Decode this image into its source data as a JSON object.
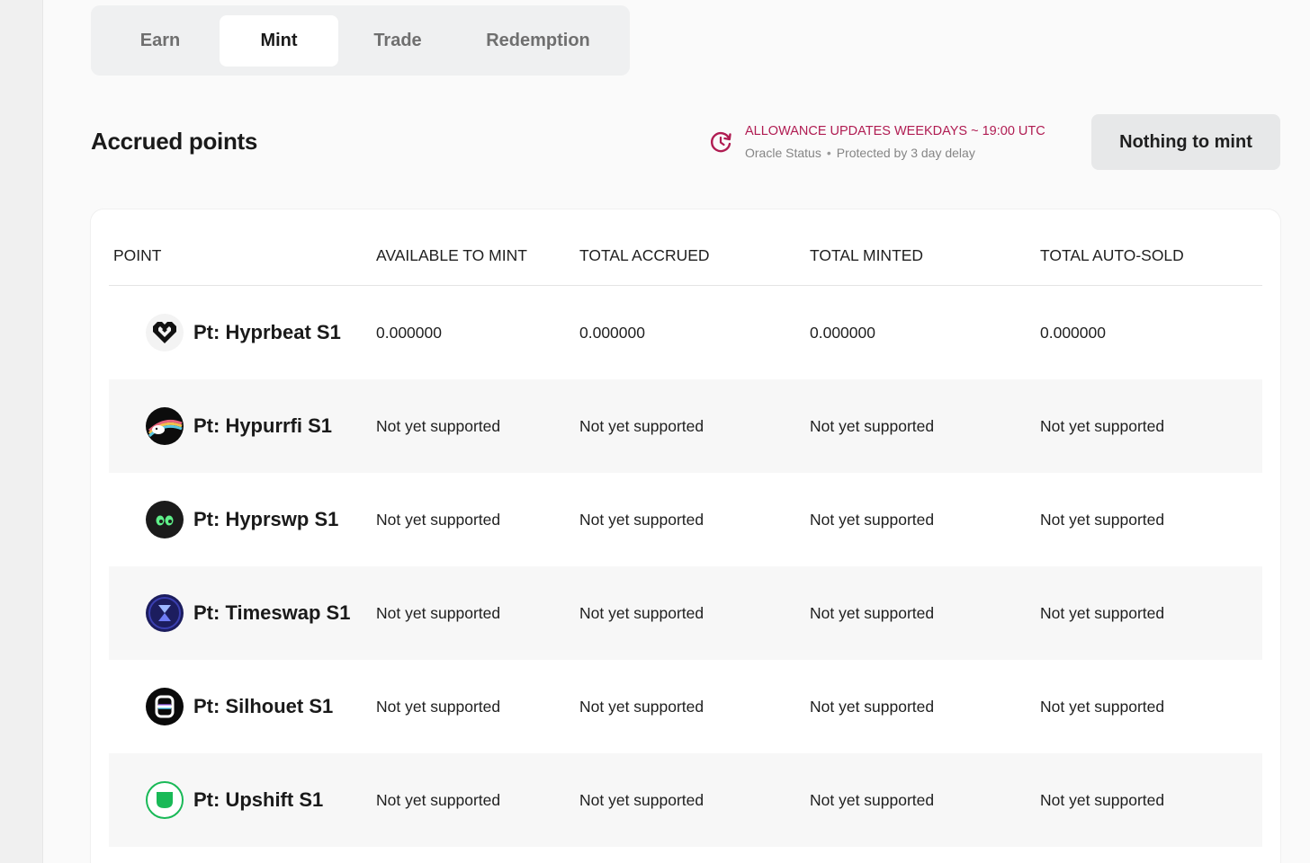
{
  "tabs": [
    {
      "label": "Earn"
    },
    {
      "label": "Mint"
    },
    {
      "label": "Trade"
    },
    {
      "label": "Redemption"
    }
  ],
  "active_tab": "Mint",
  "page_title": "Accrued points",
  "oracle": {
    "headline": "ALLOWANCE UPDATES WEEKDAYS ~ 19:00 UTC",
    "status_label": "Oracle Status",
    "separator": "•",
    "protection": "Protected by 3 day delay",
    "icon": "refresh-clock-icon",
    "color": "#b01c52"
  },
  "mint_button": {
    "label": "Nothing to mint"
  },
  "table": {
    "headers": [
      "POINT",
      "AVAILABLE TO MINT",
      "TOTAL ACCRUED",
      "TOTAL MINTED",
      "TOTAL AUTO-SOLD"
    ],
    "rows": [
      {
        "name": "Pt: Hyprbeat S1",
        "icon": "hyprbeat-logo-icon",
        "available": "0.000000",
        "accrued": "0.000000",
        "minted": "0.000000",
        "auto_sold": "0.000000"
      },
      {
        "name": "Pt: Hypurrfi S1",
        "icon": "hypurrfi-logo-icon",
        "available": "Not yet supported",
        "accrued": "Not yet supported",
        "minted": "Not yet supported",
        "auto_sold": "Not yet supported"
      },
      {
        "name": "Pt: Hyprswp S1",
        "icon": "hyprswp-logo-icon",
        "available": "Not yet supported",
        "accrued": "Not yet supported",
        "minted": "Not yet supported",
        "auto_sold": "Not yet supported"
      },
      {
        "name": "Pt: Timeswap S1",
        "icon": "timeswap-logo-icon",
        "available": "Not yet supported",
        "accrued": "Not yet supported",
        "minted": "Not yet supported",
        "auto_sold": "Not yet supported"
      },
      {
        "name": "Pt: Silhouet S1",
        "icon": "silhouet-logo-icon",
        "available": "Not yet supported",
        "accrued": "Not yet supported",
        "minted": "Not yet supported",
        "auto_sold": "Not yet supported"
      },
      {
        "name": "Pt: Upshift S1",
        "icon": "upshift-logo-icon",
        "available": "Not yet supported",
        "accrued": "Not yet supported",
        "minted": "Not yet supported",
        "auto_sold": "Not yet supported"
      }
    ]
  }
}
